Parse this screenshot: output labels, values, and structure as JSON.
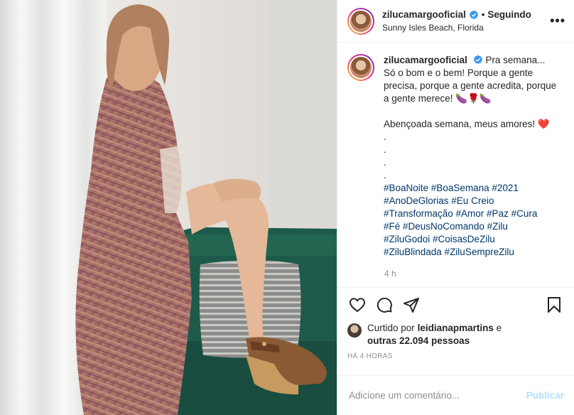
{
  "header": {
    "username": "zilucamargooficial",
    "separator": "•",
    "follow_status": "Seguindo",
    "location": "Sunny Isles Beach, Florida",
    "more_label": "•••"
  },
  "caption": {
    "username": "zilucamargooficial",
    "line1": "Pra semana... Só o bom e o bem! Porque a gente precisa, porque a gente acredita, porque a gente merece! 🍆🌹🍆",
    "line2": "Abençoada semana, meus amores! ❤️",
    "dots": [
      ".",
      ".",
      ".",
      "."
    ],
    "hashtag_lines": [
      "#BoaNoite #BoaSemana #2021",
      "#AnoDeGlorias #Eu Creio",
      "#Transformação #Amor #Paz #Cura",
      "#Fé #DeusNoComando #Zilu",
      "#ZiluGodoi #CoisasDeZilu",
      "#ZiluBlindada #ZiluSempreZilu"
    ],
    "time": "4 h"
  },
  "likes": {
    "prefix": "Curtido por",
    "liker": "leidianapmartins",
    "conj": "e",
    "others": "outras 22.094 pessoas"
  },
  "posted_ago": "HÁ 4 HORAS",
  "comment": {
    "placeholder": "Adicione um comentário...",
    "publish_label": "Publicar"
  },
  "icons": {
    "verified": "verified-badge-icon",
    "like": "heart-icon",
    "comment": "comment-icon",
    "share": "share-icon",
    "save": "bookmark-icon"
  },
  "colors": {
    "hashtag": "#00376b",
    "publish": "#b2dffc",
    "verified": "#3897f0",
    "muted": "#8e8e8e"
  }
}
